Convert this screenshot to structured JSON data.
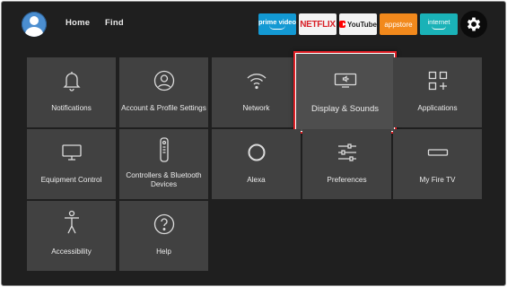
{
  "nav": {
    "home_label": "Home",
    "find_label": "Find"
  },
  "apps": {
    "prime_label": "prime video",
    "netflix_label": "NETFLIX",
    "youtube_label": "YouTube",
    "appstore_label": "appstore",
    "internet_label": "internet"
  },
  "settings": {
    "focused_tile": "Display & Sounds",
    "tiles": [
      {
        "label": "Notifications",
        "icon": "bell-icon"
      },
      {
        "label": "Account & Profile Settings",
        "icon": "user-profile-icon"
      },
      {
        "label": "Network",
        "icon": "wifi-icon"
      },
      {
        "label": "Display & Sounds",
        "icon": "tv-speaker-icon"
      },
      {
        "label": "Applications",
        "icon": "apps-grid-icon"
      },
      {
        "label": "Equipment Control",
        "icon": "monitor-icon"
      },
      {
        "label": "Controllers & Bluetooth Devices",
        "icon": "remote-icon"
      },
      {
        "label": "Alexa",
        "icon": "alexa-ring-icon"
      },
      {
        "label": "Preferences",
        "icon": "sliders-icon"
      },
      {
        "label": "My Fire TV",
        "icon": "fire-tv-stick-icon"
      },
      {
        "label": "Accessibility",
        "icon": "accessibility-icon"
      },
      {
        "label": "Help",
        "icon": "help-icon"
      }
    ]
  },
  "colors": {
    "background": "#1f1f1f",
    "tile": "#414141",
    "focus_border": "#e21f26",
    "prime": "#1399d3",
    "netflix": "#d81f26",
    "appstore": "#f2891c",
    "internet": "#1ab2b7",
    "avatar": "#4b8ed0"
  }
}
